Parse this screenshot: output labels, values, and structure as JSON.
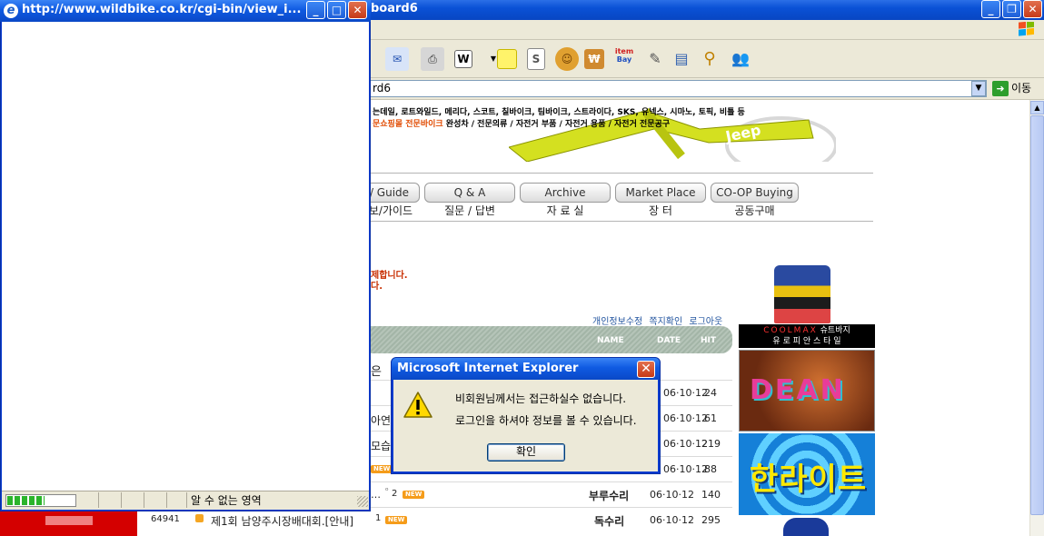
{
  "main_window": {
    "title_fragment": "board6",
    "address_fragment": "rd6",
    "go_label": "이동",
    "banner_line1": "는데일, 로트와일드, 메리다, 스코트, 칠바이크, 팀바이크, 스트라이다, SKS, 유넥스, 시마노, 토픽, 비틀 등",
    "banner_line2_orange": "문쇼핑몰 전문바이크",
    "banner_line2_rest": " 완성차 / 전문의류 / 자전거 부품 / 자전거 용품 / 자전거 전문공구",
    "nav": [
      {
        "label": "/ Guide",
        "sub": "보/가이드"
      },
      {
        "label": "Q & A",
        "sub": "질문 / 답변"
      },
      {
        "label": "Archive",
        "sub": "자 료 실"
      },
      {
        "label": "Market Place",
        "sub": "장 터"
      },
      {
        "label": "CO-OP Buying",
        "sub": "공동구매"
      }
    ],
    "notice_line1": "제합니다.",
    "notice_line2": "다.",
    "user_links": [
      "개인정보수정",
      "쪽지확인",
      "로그아웃"
    ],
    "list_header": {
      "name": "NAME",
      "date": "DATE",
      "hit": "HIT"
    },
    "rows": [
      {
        "title": "은 ",
        "date": "",
        "hit": ""
      },
      {
        "title": "",
        "date": "06·10·12",
        "hit": "24"
      },
      {
        "title": "아연즈",
        "date": "06·10·12",
        "hit": "61"
      },
      {
        "title": "모습",
        "date": "06·10·12",
        "hit": "219"
      },
      {
        "title": "",
        "date": "06·10·12",
        "hit": "88"
      },
      {
        "num": "",
        "title": "…",
        "comments": "2",
        "name": "부루수리",
        "date": "06·10·12",
        "hit": "140"
      },
      {
        "num": "64941",
        "title": "제1회 남양주시장배대회.[안내]",
        "comments": "1",
        "name": "독수리",
        "date": "06·10·12",
        "hit": "295"
      }
    ],
    "new_badge": "NEW",
    "ads": {
      "coolmax_brand": "COOLMAX",
      "coolmax_label": "슈트바지",
      "coolmax_sub": "유 로 피 안   스 타 일",
      "dean": "DEAN",
      "hanlite": "한라이트"
    }
  },
  "popup": {
    "title": "http://www.wildbike.co.kr/cgi-bin/view_i...",
    "zone_text": "알 수 없는 영역",
    "progress_fraction": 0.55
  },
  "alert": {
    "title": "Microsoft Internet Explorer",
    "line1": "비회원님께서는 접근하실수 없습니다.",
    "line2": "로그인을 하셔야 정보를 볼 수 있습니다.",
    "ok_label": "확인"
  },
  "colors": {
    "xp_blue": "#0a51d6",
    "list_header": "#a3b5a7",
    "notice_red": "#c82d00",
    "link_blue": "#2456a0",
    "badge_orange": "#f59c1a"
  }
}
